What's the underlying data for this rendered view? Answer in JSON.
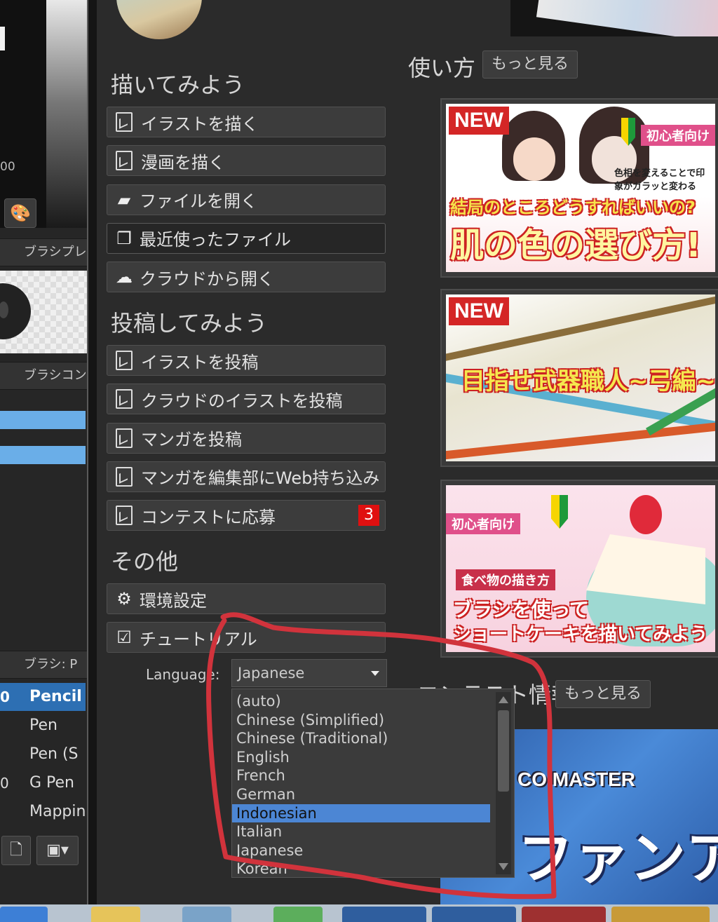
{
  "left_panel": {
    "readout": "00",
    "brush_preview_header": "ブラシプレ",
    "brush_control_header": "ブラシコント",
    "brush_list_header": "ブラシ: P",
    "brushes": [
      {
        "prefix": "0",
        "label": "Pencil",
        "selected": true
      },
      {
        "prefix": "",
        "label": "Pen",
        "selected": false
      },
      {
        "prefix": "",
        "label": "Pen (S",
        "selected": false
      },
      {
        "prefix": "0",
        "label": "G Pen",
        "selected": false
      },
      {
        "prefix": "",
        "label": "Mappin",
        "selected": false
      }
    ]
  },
  "draw_section": {
    "title": "描いてみよう",
    "buttons": [
      {
        "label": "イラストを描く",
        "icon": "document-pen-icon"
      },
      {
        "label": "漫画を描く",
        "icon": "comic-icon"
      },
      {
        "label": "ファイルを開く",
        "icon": "folder-icon"
      },
      {
        "label": "最近使ったファイル",
        "icon": "recent-files-icon"
      },
      {
        "label": "クラウドから開く",
        "icon": "cloud-folder-icon"
      }
    ]
  },
  "post_section": {
    "title": "投稿してみよう",
    "buttons": [
      {
        "label": "イラストを投稿",
        "icon": "document-pen-icon"
      },
      {
        "label": "クラウドのイラストを投稿",
        "icon": "document-pen-icon"
      },
      {
        "label": "マンガを投稿",
        "icon": "document-pen-icon"
      },
      {
        "label": "マンガを編集部にWeb持ち込み",
        "icon": "document-pen-icon"
      },
      {
        "label": "コンテストに応募",
        "icon": "document-pen-icon",
        "badge": "3"
      }
    ]
  },
  "other_section": {
    "title": "その他",
    "buttons": [
      {
        "label": "環境設定",
        "icon": "gear-icon"
      },
      {
        "label": "チュートリアル",
        "icon": "tutorial-icon"
      }
    ]
  },
  "language": {
    "label": "Language:",
    "selected": "Japanese",
    "options": [
      "(auto)",
      "Chinese (Simplified)",
      "Chinese (Traditional)",
      "English",
      "French",
      "German",
      "Indonesian",
      "Italian",
      "Japanese",
      "Korean"
    ],
    "highlighted": "Indonesian"
  },
  "howto": {
    "title": "使い方",
    "more_label": "もっと見る",
    "cards": [
      {
        "badge": "NEW",
        "caption": "肌の色の選び方!",
        "subcaption": "結局のところどうすればいいの?",
        "tag": "初心者向け",
        "note": "色相を変えることで印象がガラッと変わる"
      },
      {
        "badge": "NEW",
        "caption": "目指せ武器職人~弓編~"
      },
      {
        "tag": "初心者向け",
        "tag2": "食べ物の描き方",
        "caption": "ブラシを使って",
        "caption2": "ショートケーキを描いてみよう"
      }
    ]
  },
  "contest": {
    "title": "コンテスト情報",
    "more_label": "もっと見る",
    "banner_text": "CO  MASTER",
    "banner_sub": "ファンアー"
  },
  "colors": {
    "annotation": "#d1333c",
    "highlight": "#4c86d4",
    "badge": "#e01010",
    "selected_brush": "#2d6fb3"
  }
}
